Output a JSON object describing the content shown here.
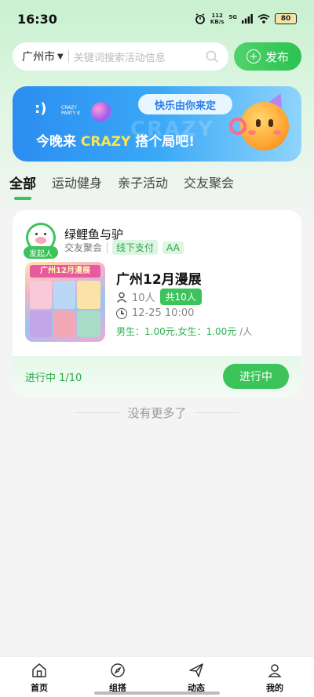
{
  "status_bar": {
    "time": "16:30",
    "net_speed_value": "112",
    "net_speed_unit": "KB/s",
    "network": "5G",
    "battery": "80"
  },
  "search": {
    "city": "广州市",
    "placeholder": "关键词搜索活动信息"
  },
  "publish_label": "发布",
  "banner": {
    "tagline": "快乐由你来定",
    "logo_text": "CRAZY PARTY K",
    "ghost_text": "CRAZY",
    "headline_prefix": "今晚来",
    "headline_highlight": "CRAZY",
    "headline_suffix": "搭个局吧!"
  },
  "tabs": [
    {
      "label": "全部",
      "active": true
    },
    {
      "label": "运动健身",
      "active": false
    },
    {
      "label": "亲子活动",
      "active": false
    },
    {
      "label": "交友聚会",
      "active": false
    }
  ],
  "event_card": {
    "host_name": "绿鲤鱼与驴",
    "initiator_label": "发起人",
    "category": "交友聚会",
    "tags": [
      "线下支付",
      "AA"
    ],
    "thumb_title": "广州12月漫展",
    "title": "广州12月漫展",
    "people": "10人",
    "total_badge": "共10人",
    "datetime": "12-25 10:00",
    "price": "男生：1.00元,女生：1.00元",
    "price_unit": " /人",
    "progress": "进行中 1/10",
    "status_button": "进行中"
  },
  "no_more_text": "没有更多了",
  "bottom_nav": [
    {
      "label": "首页",
      "icon": "home-icon"
    },
    {
      "label": "组搭",
      "icon": "compass-icon"
    },
    {
      "label": "动态",
      "icon": "send-icon"
    },
    {
      "label": "我的",
      "icon": "profile-icon"
    }
  ],
  "colors": {
    "accent": "#3cc35a",
    "banner_blue": "#2b8df0",
    "highlight_yellow": "#ffe54a"
  }
}
